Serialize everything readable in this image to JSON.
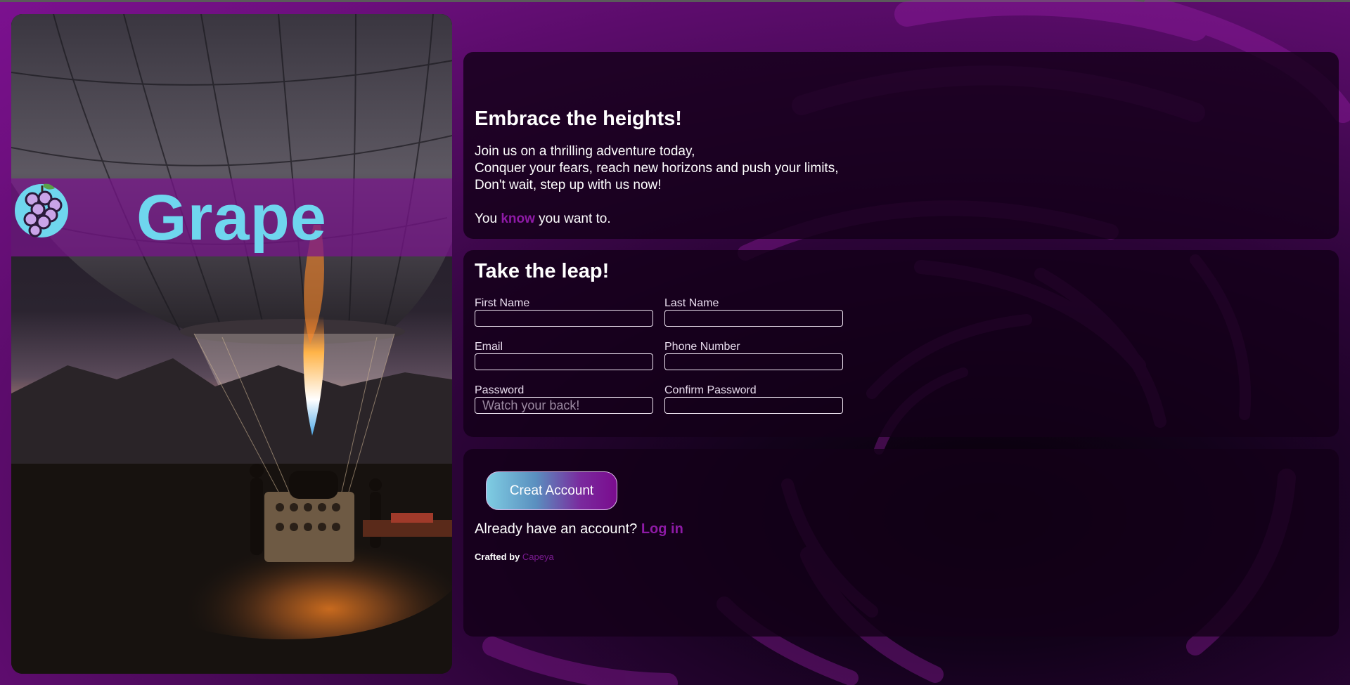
{
  "brand": {
    "name": "Grape",
    "accent_color": "#6fd6ee",
    "logo_icon": "grape-icon"
  },
  "hero": {
    "title": "Embrace the heights!",
    "line1": "Join us on a thrilling adventure today,",
    "line2": "Conquer your fears, reach new horizons and push your limits,",
    "line3": "Don't wait, step up with us now!",
    "tagline_prefix": "You ",
    "tagline_emphasis": "know",
    "tagline_suffix": " you want to."
  },
  "form": {
    "title": "Take the leap!",
    "fields": {
      "first_name": {
        "label": "First Name",
        "value": "",
        "placeholder": ""
      },
      "last_name": {
        "label": "Last Name",
        "value": "",
        "placeholder": ""
      },
      "email": {
        "label": "Email",
        "value": "",
        "placeholder": ""
      },
      "phone": {
        "label": "Phone Number",
        "value": "",
        "placeholder": ""
      },
      "password": {
        "label": "Password",
        "value": "",
        "placeholder": "Watch your back!"
      },
      "confirm_password": {
        "label": "Confirm Password",
        "value": "",
        "placeholder": ""
      }
    }
  },
  "actions": {
    "create_button": "Creat Account",
    "login_prompt": "Already have an account? ",
    "login_link": "Log in",
    "crafted_prefix": "Crafted by ",
    "crafted_author": "Capeya"
  },
  "colors": {
    "background": "#4d0a5c",
    "card": "#140018",
    "link": "#8e1aa6"
  }
}
